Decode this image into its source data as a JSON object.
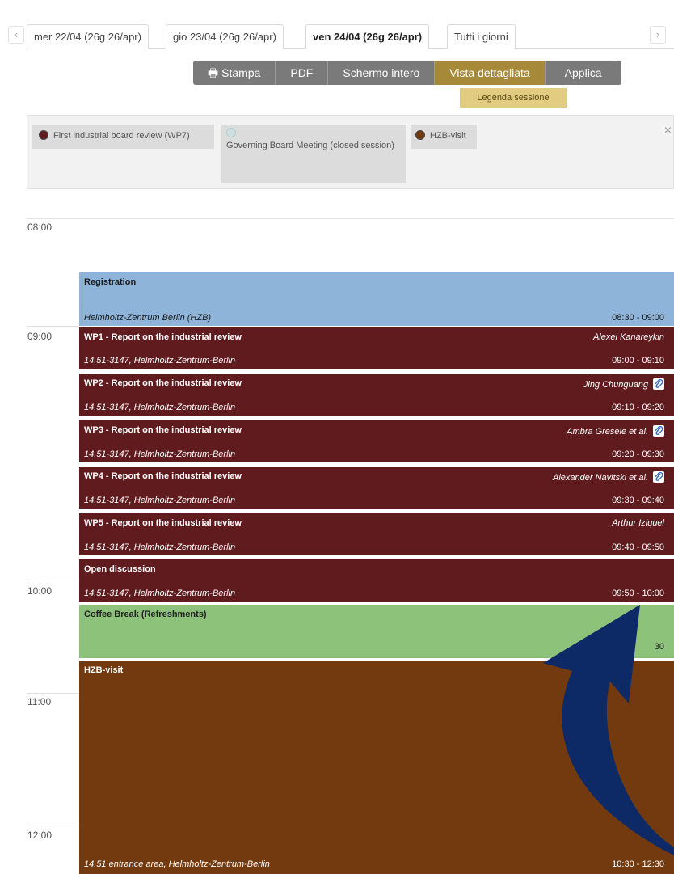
{
  "tabs": {
    "prev": "‹",
    "next": "›",
    "items": [
      {
        "label": "mer 22/04 (26g 26/apr)"
      },
      {
        "label": "gio 23/04 (26g 26/apr)"
      },
      {
        "label": "ven 24/04 (26g 26/apr)"
      },
      {
        "label": "Tutti i giorni"
      }
    ]
  },
  "toolbar": {
    "print": "Stampa",
    "pdf": "PDF",
    "fullscreen": "Schermo intero",
    "detailed": "Vista dettagliata",
    "apply": "Applica",
    "legend_tag": "Legenda sessione"
  },
  "legend": {
    "close": "×",
    "items": [
      {
        "label": "First industrial board review (WP7)",
        "color": "#601b1f"
      },
      {
        "label": "Governing Board Meeting (closed session)",
        "color": "#cfe0e3"
      },
      {
        "label": "HZB-visit",
        "color": "#723a0e"
      }
    ]
  },
  "hours": [
    "08:00",
    "09:00",
    "10:00",
    "11:00",
    "12:00"
  ],
  "entries": [
    {
      "title": "Registration",
      "speaker": "",
      "location": "Helmholtz-Zentrum Berlin (HZB)",
      "time": "08:30 - 09:00",
      "color": "#8fb4d9"
    },
    {
      "title": "WP1 - Report on the industrial review",
      "speaker": "Alexei Kanareykin",
      "location": "14.51-3147, Helmholtz-Zentrum-Berlin",
      "time": "09:00 - 09:10",
      "color": "#601b1f"
    },
    {
      "title": "WP2 - Report on the industrial review",
      "speaker": "Jing Chunguang",
      "location": "14.51-3147, Helmholtz-Zentrum-Berlin",
      "time": "09:10 - 09:20",
      "color": "#601b1f"
    },
    {
      "title": "WP3 - Report on the industrial review",
      "speaker": "Ambra Gresele et al.",
      "location": "14.51-3147, Helmholtz-Zentrum-Berlin",
      "time": "09:20 - 09:30",
      "color": "#601b1f"
    },
    {
      "title": "WP4 - Report on the industrial review",
      "speaker": "Alexander Navitski et al.",
      "location": "14.51-3147, Helmholtz-Zentrum-Berlin",
      "time": "09:30 - 09:40",
      "color": "#601b1f"
    },
    {
      "title": "WP5 - Report on the industrial review",
      "speaker": "Arthur Iziquel",
      "location": "14.51-3147, Helmholtz-Zentrum-Berlin",
      "time": "09:40 - 09:50",
      "color": "#601b1f"
    },
    {
      "title": "Open discussion",
      "speaker": "",
      "location": "14.51-3147, Helmholtz-Zentrum-Berlin",
      "time": "09:50 - 10:00",
      "color": "#601b1f"
    },
    {
      "title": "Coffee Break (Refreshments)",
      "speaker": "",
      "location": "",
      "time": "30",
      "color": "#8dc27a"
    },
    {
      "title": "HZB-visit",
      "speaker": "",
      "location": "14.51 entrance area, Helmholtz-Zentrum-Berlin",
      "time": "10:30 - 12:30",
      "color": "#723a0e"
    }
  ],
  "arrow_color": "#0e2a66"
}
